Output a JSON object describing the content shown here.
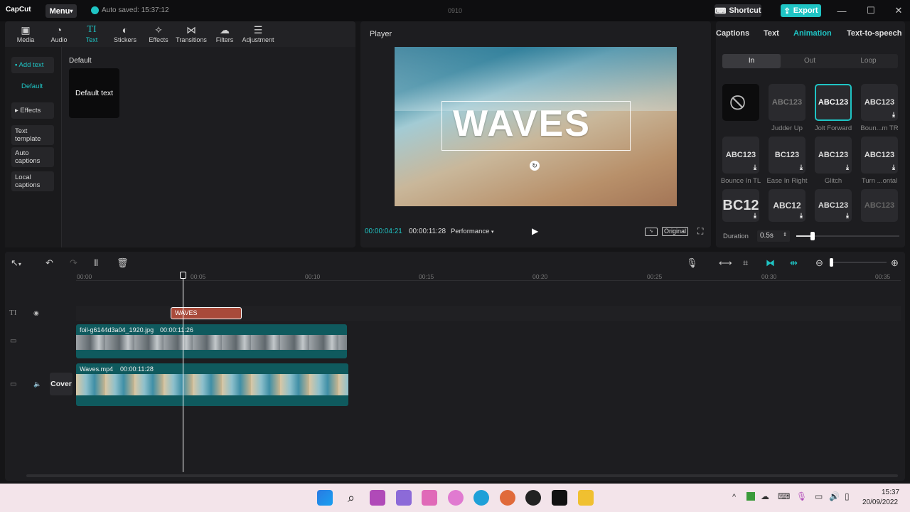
{
  "app": {
    "logo": "CapCut",
    "menu_label": "Menu",
    "autosave": "Auto saved: 15:37:12",
    "project_name": "0910",
    "shortcut_label": "Shortcut",
    "export_label": "Export"
  },
  "toolbar": {
    "items": [
      {
        "label": "Media",
        "icon": "media-icon"
      },
      {
        "label": "Audio",
        "icon": "audio-icon"
      },
      {
        "label": "Text",
        "icon": "text-icon"
      },
      {
        "label": "Stickers",
        "icon": "stickers-icon"
      },
      {
        "label": "Effects",
        "icon": "effects-icon"
      },
      {
        "label": "Transitions",
        "icon": "transitions-icon"
      },
      {
        "label": "Filters",
        "icon": "filters-icon"
      },
      {
        "label": "Adjustment",
        "icon": "adjustment-icon"
      }
    ],
    "active": "Text"
  },
  "sidebar": {
    "items": [
      "Add text",
      "Default",
      "Effects",
      "Text template",
      "Auto captions",
      "Local captions"
    ]
  },
  "text_panel": {
    "section": "Default",
    "card_label": "Default text"
  },
  "player": {
    "title": "Player",
    "overlay_text": "WAVES",
    "current_time": "00:00:04:21",
    "total_time": "00:00:11:28",
    "quality": "Performance",
    "original_label": "Original"
  },
  "right_panel": {
    "tabs": [
      "Captions",
      "Text",
      "Animation",
      "Text-to-speech"
    ],
    "active_tab": "Animation",
    "subtabs": [
      "In",
      "Out",
      "Loop"
    ],
    "active_subtab": "In",
    "animations": [
      {
        "label": "",
        "preview": ""
      },
      {
        "label": "Judder Up",
        "preview": "ABC123"
      },
      {
        "label": "Jolt Forward",
        "preview": "ABC123"
      },
      {
        "label": "Boun...m TR",
        "preview": "ABC123"
      },
      {
        "label": "Bounce In TL",
        "preview": "ABC123"
      },
      {
        "label": "Ease In Right",
        "preview": "BC123"
      },
      {
        "label": "Glitch",
        "preview": "ABC123"
      },
      {
        "label": "Turn ...ontal",
        "preview": "ABC123"
      },
      {
        "label": "",
        "preview": "BC12"
      },
      {
        "label": "",
        "preview": "ABC12"
      },
      {
        "label": "",
        "preview": "ABC123"
      },
      {
        "label": "",
        "preview": "ABC123"
      }
    ],
    "duration_label": "Duration",
    "duration_value": "0.5s"
  },
  "timeline": {
    "ruler": [
      "00:00",
      "00:05",
      "00:10",
      "00:15",
      "00:20",
      "00:25",
      "00:30",
      "00:35"
    ],
    "text_clip": "WAVES",
    "overlay_clip": {
      "name": "foil-g6144d3a04_1920.jpg",
      "duration": "00:00:11:26"
    },
    "main_clip": {
      "name": "Waves.mp4",
      "duration": "00:00:11:28"
    },
    "cover_label": "Cover"
  },
  "taskbar": {
    "time": "15:37",
    "date": "20/09/2022"
  },
  "colors": {
    "accent": "#1fc4c4",
    "text_clip": "#a84a3a",
    "video_clip": "#0f5a5e"
  }
}
